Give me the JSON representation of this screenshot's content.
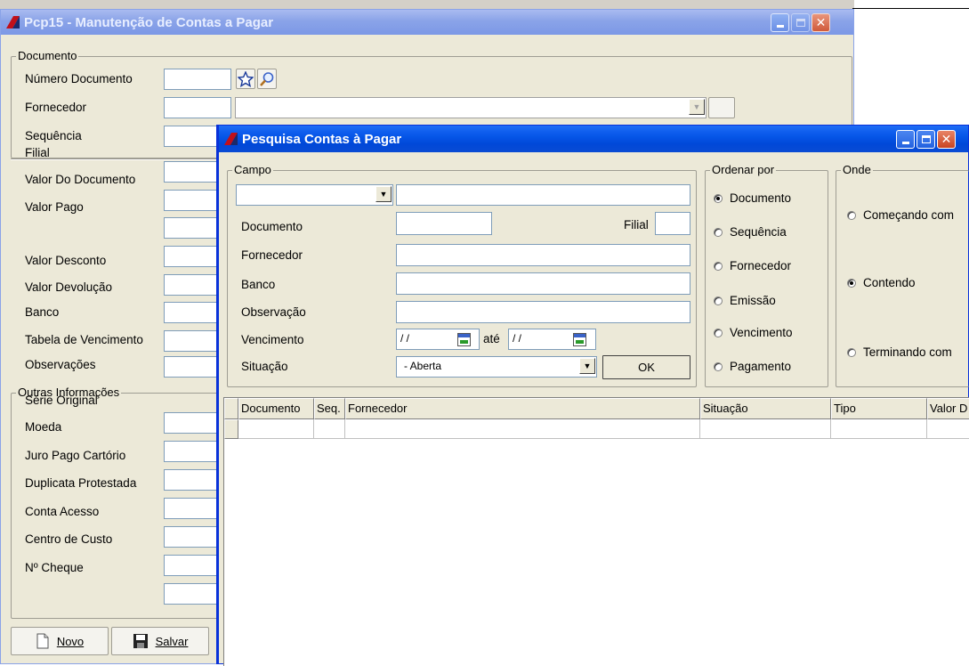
{
  "main_window": {
    "title": "Pcp15 - Manutenção de Contas a Pagar",
    "doc_group": {
      "legend": "Documento",
      "numero_documento": "Número Documento",
      "fornecedor": "Fornecedor",
      "sequencia": "Sequência"
    },
    "fields_labels": {
      "filial": "Filial",
      "valor_documento": "Valor Do Documento",
      "valor_pago": "Valor Pago",
      "valor_desconto": "Valor Desconto",
      "valor_devolucao": "Valor Devolução",
      "banco": "Banco",
      "tabela_vencimento": "Tabela de Vencimento",
      "observacoes": "Observações"
    },
    "outras_group": {
      "legend": "Outras Informações",
      "serie_original": "Série Original",
      "moeda": "Moeda",
      "juro_pago": "Juro Pago Cartório",
      "duplicata": "Duplicata Protestada",
      "conta_acesso": "Conta Acesso",
      "centro_custo": "Centro de Custo",
      "cheque": "Nº Cheque"
    },
    "toolbar": {
      "novo": "Novo",
      "salvar": "Salvar"
    }
  },
  "search_window": {
    "title": "Pesquisa Contas à Pagar",
    "campo_group": {
      "legend": "Campo",
      "documento": "Documento",
      "filial": "Filial",
      "fornecedor": "Fornecedor",
      "banco": "Banco",
      "observacao": "Observação",
      "vencimento": "Vencimento",
      "date_from": "/ /",
      "ate": "até",
      "date_to": "/ /",
      "situacao": "Situação",
      "situacao_value": "- Aberta",
      "ok": "OK"
    },
    "ordenar_group": {
      "legend": "Ordenar por",
      "options": [
        "Documento",
        "Sequência",
        "Fornecedor",
        "Emissão",
        "Vencimento",
        "Pagamento"
      ],
      "selected": "Documento"
    },
    "onde_group": {
      "legend": "Onde",
      "options": [
        "Começando com",
        "Contendo",
        "Terminando com"
      ],
      "selected": "Contendo"
    },
    "grid": {
      "columns": [
        "Documento",
        "Seq.",
        "Fornecedor",
        "Situação",
        "Tipo",
        "Valor D"
      ]
    }
  },
  "colors": {
    "active_title": "#0656e8",
    "inactive_title": "#8aa3e8",
    "window_bg": "#ece9d8"
  }
}
